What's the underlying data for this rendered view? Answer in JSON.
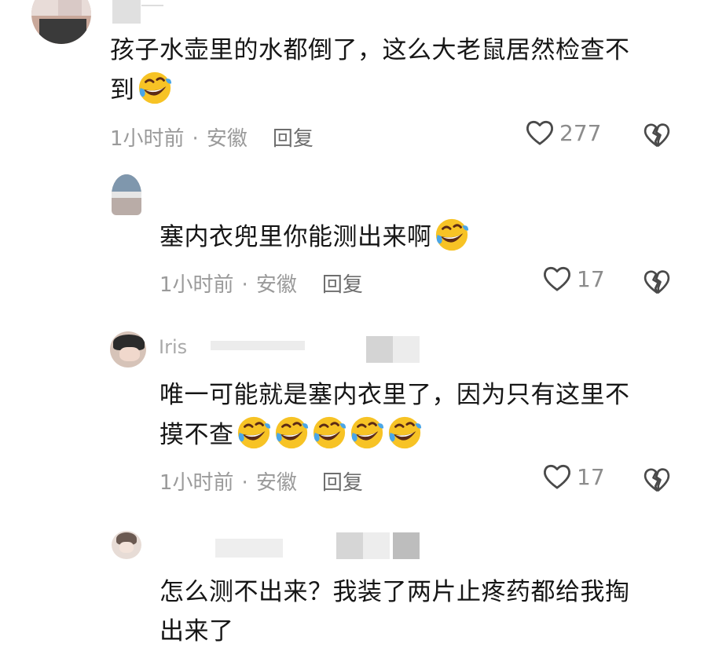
{
  "comments": [
    {
      "text_line1": "孩子水壶里的水都倒了，这么大老鼠居然检查不",
      "text_line2": "到",
      "time": "1小时前",
      "location": "安徽",
      "reply": "回复",
      "likes": "277"
    },
    {
      "text": "塞内衣兜里你能测出来啊",
      "time": "1小时前",
      "location": "安徽",
      "reply": "回复",
      "likes": "17"
    },
    {
      "username": "Iris",
      "text_line1": "唯一可能就是塞内衣里了，因为只有这里不",
      "text_line2": "摸不查",
      "time": "1小时前",
      "location": "安徽",
      "reply": "回复",
      "likes": "17"
    },
    {
      "text_line1": "怎么测不出来？我装了两片止疼药都给我掏",
      "text_line2": "出来了"
    }
  ],
  "separator": "·"
}
